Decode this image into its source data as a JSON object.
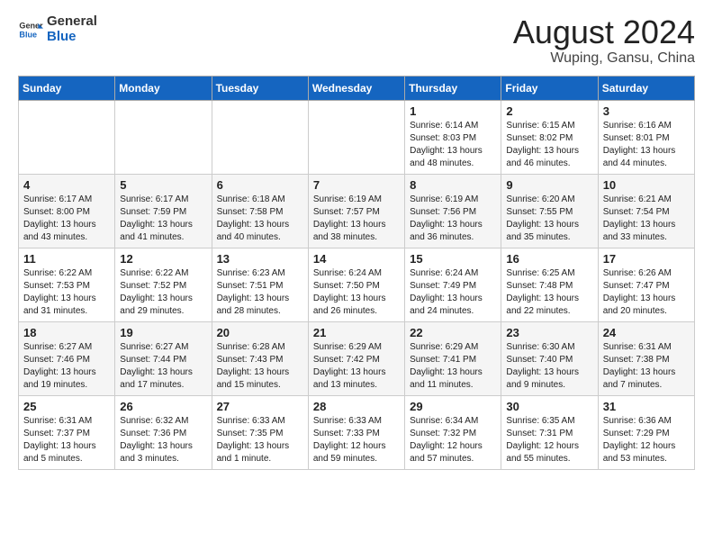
{
  "header": {
    "logo_general": "General",
    "logo_blue": "Blue",
    "title": "August 2024",
    "subtitle": "Wuping, Gansu, China"
  },
  "days_of_week": [
    "Sunday",
    "Monday",
    "Tuesday",
    "Wednesday",
    "Thursday",
    "Friday",
    "Saturday"
  ],
  "weeks": [
    [
      {
        "day": "",
        "text": ""
      },
      {
        "day": "",
        "text": ""
      },
      {
        "day": "",
        "text": ""
      },
      {
        "day": "",
        "text": ""
      },
      {
        "day": "1",
        "text": "Sunrise: 6:14 AM\nSunset: 8:03 PM\nDaylight: 13 hours\nand 48 minutes."
      },
      {
        "day": "2",
        "text": "Sunrise: 6:15 AM\nSunset: 8:02 PM\nDaylight: 13 hours\nand 46 minutes."
      },
      {
        "day": "3",
        "text": "Sunrise: 6:16 AM\nSunset: 8:01 PM\nDaylight: 13 hours\nand 44 minutes."
      }
    ],
    [
      {
        "day": "4",
        "text": "Sunrise: 6:17 AM\nSunset: 8:00 PM\nDaylight: 13 hours\nand 43 minutes."
      },
      {
        "day": "5",
        "text": "Sunrise: 6:17 AM\nSunset: 7:59 PM\nDaylight: 13 hours\nand 41 minutes."
      },
      {
        "day": "6",
        "text": "Sunrise: 6:18 AM\nSunset: 7:58 PM\nDaylight: 13 hours\nand 40 minutes."
      },
      {
        "day": "7",
        "text": "Sunrise: 6:19 AM\nSunset: 7:57 PM\nDaylight: 13 hours\nand 38 minutes."
      },
      {
        "day": "8",
        "text": "Sunrise: 6:19 AM\nSunset: 7:56 PM\nDaylight: 13 hours\nand 36 minutes."
      },
      {
        "day": "9",
        "text": "Sunrise: 6:20 AM\nSunset: 7:55 PM\nDaylight: 13 hours\nand 35 minutes."
      },
      {
        "day": "10",
        "text": "Sunrise: 6:21 AM\nSunset: 7:54 PM\nDaylight: 13 hours\nand 33 minutes."
      }
    ],
    [
      {
        "day": "11",
        "text": "Sunrise: 6:22 AM\nSunset: 7:53 PM\nDaylight: 13 hours\nand 31 minutes."
      },
      {
        "day": "12",
        "text": "Sunrise: 6:22 AM\nSunset: 7:52 PM\nDaylight: 13 hours\nand 29 minutes."
      },
      {
        "day": "13",
        "text": "Sunrise: 6:23 AM\nSunset: 7:51 PM\nDaylight: 13 hours\nand 28 minutes."
      },
      {
        "day": "14",
        "text": "Sunrise: 6:24 AM\nSunset: 7:50 PM\nDaylight: 13 hours\nand 26 minutes."
      },
      {
        "day": "15",
        "text": "Sunrise: 6:24 AM\nSunset: 7:49 PM\nDaylight: 13 hours\nand 24 minutes."
      },
      {
        "day": "16",
        "text": "Sunrise: 6:25 AM\nSunset: 7:48 PM\nDaylight: 13 hours\nand 22 minutes."
      },
      {
        "day": "17",
        "text": "Sunrise: 6:26 AM\nSunset: 7:47 PM\nDaylight: 13 hours\nand 20 minutes."
      }
    ],
    [
      {
        "day": "18",
        "text": "Sunrise: 6:27 AM\nSunset: 7:46 PM\nDaylight: 13 hours\nand 19 minutes."
      },
      {
        "day": "19",
        "text": "Sunrise: 6:27 AM\nSunset: 7:44 PM\nDaylight: 13 hours\nand 17 minutes."
      },
      {
        "day": "20",
        "text": "Sunrise: 6:28 AM\nSunset: 7:43 PM\nDaylight: 13 hours\nand 15 minutes."
      },
      {
        "day": "21",
        "text": "Sunrise: 6:29 AM\nSunset: 7:42 PM\nDaylight: 13 hours\nand 13 minutes."
      },
      {
        "day": "22",
        "text": "Sunrise: 6:29 AM\nSunset: 7:41 PM\nDaylight: 13 hours\nand 11 minutes."
      },
      {
        "day": "23",
        "text": "Sunrise: 6:30 AM\nSunset: 7:40 PM\nDaylight: 13 hours\nand 9 minutes."
      },
      {
        "day": "24",
        "text": "Sunrise: 6:31 AM\nSunset: 7:38 PM\nDaylight: 13 hours\nand 7 minutes."
      }
    ],
    [
      {
        "day": "25",
        "text": "Sunrise: 6:31 AM\nSunset: 7:37 PM\nDaylight: 13 hours\nand 5 minutes."
      },
      {
        "day": "26",
        "text": "Sunrise: 6:32 AM\nSunset: 7:36 PM\nDaylight: 13 hours\nand 3 minutes."
      },
      {
        "day": "27",
        "text": "Sunrise: 6:33 AM\nSunset: 7:35 PM\nDaylight: 13 hours\nand 1 minute."
      },
      {
        "day": "28",
        "text": "Sunrise: 6:33 AM\nSunset: 7:33 PM\nDaylight: 12 hours\nand 59 minutes."
      },
      {
        "day": "29",
        "text": "Sunrise: 6:34 AM\nSunset: 7:32 PM\nDaylight: 12 hours\nand 57 minutes."
      },
      {
        "day": "30",
        "text": "Sunrise: 6:35 AM\nSunset: 7:31 PM\nDaylight: 12 hours\nand 55 minutes."
      },
      {
        "day": "31",
        "text": "Sunrise: 6:36 AM\nSunset: 7:29 PM\nDaylight: 12 hours\nand 53 minutes."
      }
    ]
  ]
}
